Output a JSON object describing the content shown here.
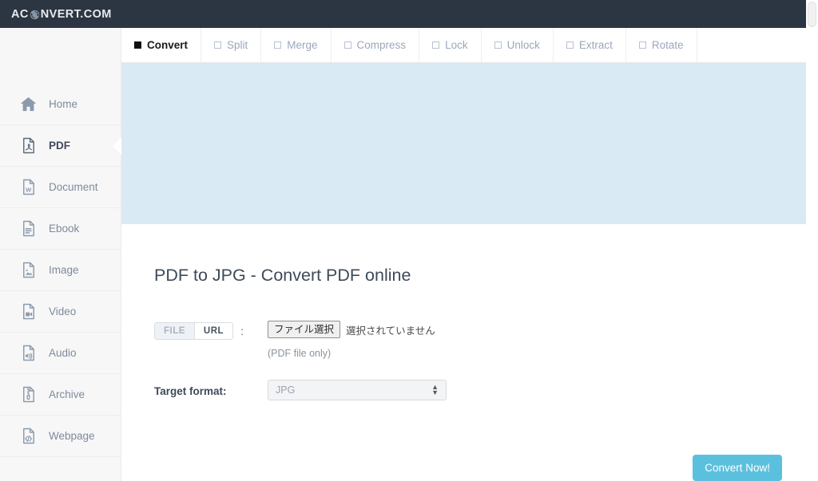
{
  "header": {
    "logo_prefix": "AC",
    "logo_icon": "convert-circular-arrows-icon",
    "logo_suffix": "NVERT.COM",
    "background_color": "#2c3542"
  },
  "sidebar": {
    "items": [
      {
        "label": "Home",
        "icon": "home-icon",
        "active": false
      },
      {
        "label": "PDF",
        "icon": "pdf-file-icon",
        "active": true
      },
      {
        "label": "Document",
        "icon": "word-document-icon",
        "active": false
      },
      {
        "label": "Ebook",
        "icon": "ebook-file-icon",
        "active": false
      },
      {
        "label": "Image",
        "icon": "image-file-icon",
        "active": false
      },
      {
        "label": "Video",
        "icon": "video-file-icon",
        "active": false
      },
      {
        "label": "Audio",
        "icon": "audio-file-icon",
        "active": false
      },
      {
        "label": "Archive",
        "icon": "archive-file-icon",
        "active": false
      },
      {
        "label": "Webpage",
        "icon": "webpage-code-file-icon",
        "active": false
      }
    ]
  },
  "tabs": [
    {
      "label": "Convert",
      "active": true
    },
    {
      "label": "Split",
      "active": false
    },
    {
      "label": "Merge",
      "active": false
    },
    {
      "label": "Compress",
      "active": false
    },
    {
      "label": "Lock",
      "active": false
    },
    {
      "label": "Unlock",
      "active": false
    },
    {
      "label": "Extract",
      "active": false
    },
    {
      "label": "Rotate",
      "active": false
    }
  ],
  "banner": {
    "color": "#d9eaf5"
  },
  "main": {
    "title": "PDF to JPG - Convert PDF online",
    "source": {
      "file_tab": "FILE",
      "url_tab": "URL",
      "selected": "FILE",
      "separator": ":",
      "file_button": "ファイル選択",
      "file_status": "選択されていません",
      "hint": "(PDF file only)"
    },
    "format": {
      "label": "Target format:",
      "value": "JPG",
      "arrows": "▲▼"
    },
    "submit": {
      "label": "Convert Now!",
      "color": "#5bc0de"
    }
  }
}
